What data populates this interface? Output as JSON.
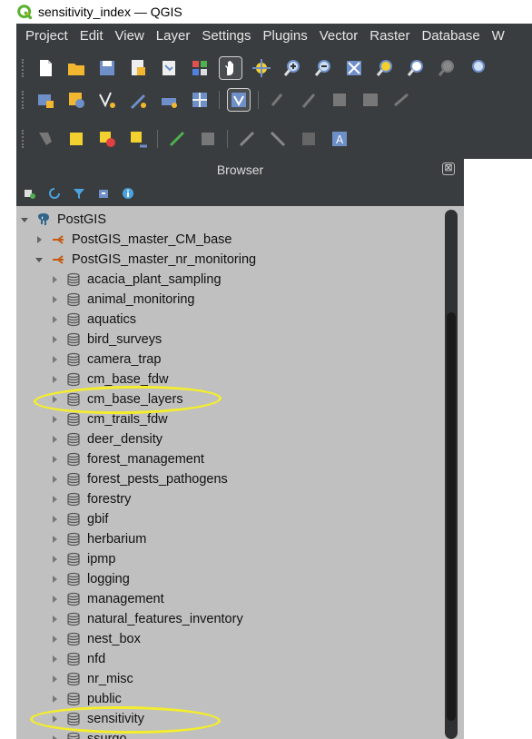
{
  "window": {
    "title": "sensitivity_index — QGIS"
  },
  "menubar": {
    "items": [
      {
        "label": "Project"
      },
      {
        "label": "Edit"
      },
      {
        "label": "View"
      },
      {
        "label": "Layer"
      },
      {
        "label": "Settings"
      },
      {
        "label": "Plugins"
      },
      {
        "label": "Vector"
      },
      {
        "label": "Raster"
      },
      {
        "label": "Database"
      },
      {
        "label": "W"
      }
    ]
  },
  "browser": {
    "title": "Browser",
    "close_glyph": "⊠",
    "tree": {
      "root": {
        "label": "PostGIS",
        "icon": "postgis-elephant-icon"
      },
      "connections": [
        {
          "label": "PostGIS_master_CM_base",
          "expanded": false
        },
        {
          "label": "PostGIS_master_nr_monitoring",
          "expanded": true
        }
      ],
      "schemas": [
        {
          "label": "acacia_plant_sampling"
        },
        {
          "label": "animal_monitoring"
        },
        {
          "label": "aquatics"
        },
        {
          "label": "bird_surveys"
        },
        {
          "label": "camera_trap"
        },
        {
          "label": "cm_base_fdw"
        },
        {
          "label": "cm_base_layers"
        },
        {
          "label": "cm_trails_fdw"
        },
        {
          "label": "deer_density"
        },
        {
          "label": "forest_management"
        },
        {
          "label": "forest_pests_pathogens"
        },
        {
          "label": "forestry"
        },
        {
          "label": "gbif"
        },
        {
          "label": "herbarium"
        },
        {
          "label": "ipmp"
        },
        {
          "label": "logging"
        },
        {
          "label": "management"
        },
        {
          "label": "natural_features_inventory"
        },
        {
          "label": "nest_box"
        },
        {
          "label": "nfd"
        },
        {
          "label": "nr_misc"
        },
        {
          "label": "public"
        },
        {
          "label": "sensitivity"
        },
        {
          "label": "ssurgo"
        }
      ]
    }
  },
  "colors": {
    "toolbar_bg": "#3a3d3f",
    "panel_bg": "#c0c0c0",
    "highlight": "#f4ee2a"
  }
}
